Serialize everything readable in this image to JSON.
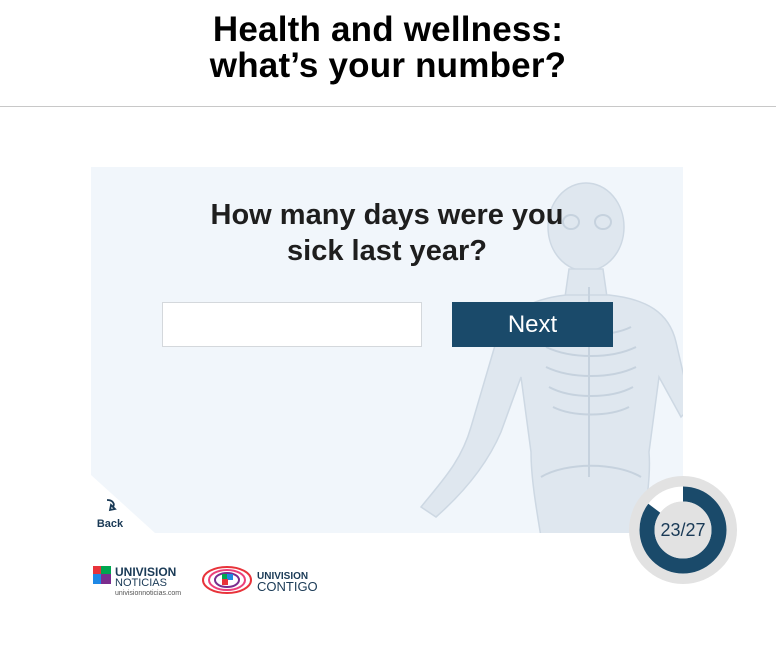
{
  "header": {
    "title_line1": "Health and wellness:",
    "title_line2": "what’s your number?"
  },
  "quiz": {
    "question_line1": "How many days were you",
    "question_line2": "sick last year?",
    "answer_value": "",
    "next_label": "Next",
    "back_label": "Back",
    "progress_current": 23,
    "progress_total": 27,
    "progress_text": "23/27"
  },
  "footer": {
    "logo1_line1": "UNIVISION",
    "logo1_line2": "NOTICIAS",
    "logo1_url": "univisionnoticias.com",
    "logo2_line1": "UNIVISION",
    "logo2_line2": "CONTIGO"
  },
  "colors": {
    "primary": "#1a4a6a",
    "card_background": "#f1f6fb",
    "ring_track": "#dddddd",
    "ring_fill": "#1a4a6a"
  },
  "icons": {
    "back": "back-arrow-icon",
    "anatomy": "anatomy-figure-image"
  }
}
